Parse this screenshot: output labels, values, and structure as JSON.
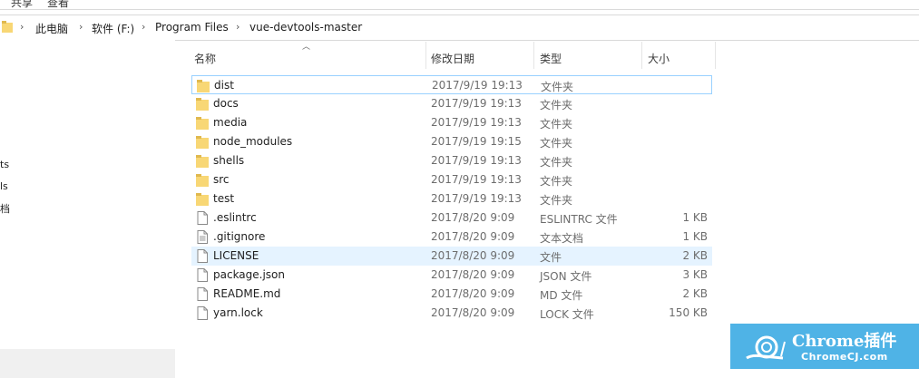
{
  "menu": {
    "items": [
      "共享",
      "查看"
    ]
  },
  "address_bar": {
    "crumbs": [
      "此电脑",
      "软件 (F:)",
      "Program Files",
      "vue-devtools-master"
    ]
  },
  "nav_pane": {
    "fragments": [
      "ts",
      "ls",
      "档"
    ]
  },
  "columns": {
    "name": "名称",
    "date": "修改日期",
    "type": "类型",
    "size": "大小"
  },
  "files": [
    {
      "name": "dist",
      "date": "2017/9/19 19:13",
      "type": "文件夹",
      "size": "",
      "icon": "folder-icon"
    },
    {
      "name": "docs",
      "date": "2017/9/19 19:13",
      "type": "文件夹",
      "size": "",
      "icon": "folder-icon"
    },
    {
      "name": "media",
      "date": "2017/9/19 19:13",
      "type": "文件夹",
      "size": "",
      "icon": "folder-icon"
    },
    {
      "name": "node_modules",
      "date": "2017/9/19 19:15",
      "type": "文件夹",
      "size": "",
      "icon": "folder-icon"
    },
    {
      "name": "shells",
      "date": "2017/9/19 19:13",
      "type": "文件夹",
      "size": "",
      "icon": "folder-icon"
    },
    {
      "name": "src",
      "date": "2017/9/19 19:13",
      "type": "文件夹",
      "size": "",
      "icon": "folder-icon"
    },
    {
      "name": "test",
      "date": "2017/9/19 19:13",
      "type": "文件夹",
      "size": "",
      "icon": "folder-icon"
    },
    {
      "name": ".eslintrc",
      "date": "2017/8/20 9:09",
      "type": "ESLINTRC 文件",
      "size": "1 KB",
      "icon": "file-icon"
    },
    {
      "name": ".gitignore",
      "date": "2017/8/20 9:09",
      "type": "文本文档",
      "size": "1 KB",
      "icon": "text-file-icon"
    },
    {
      "name": "LICENSE",
      "date": "2017/8/20 9:09",
      "type": "文件",
      "size": "2 KB",
      "icon": "file-icon"
    },
    {
      "name": "package.json",
      "date": "2017/8/20 9:09",
      "type": "JSON 文件",
      "size": "3 KB",
      "icon": "file-icon"
    },
    {
      "name": "README.md",
      "date": "2017/8/20 9:09",
      "type": "MD 文件",
      "size": "2 KB",
      "icon": "file-icon"
    },
    {
      "name": "yarn.lock",
      "date": "2017/8/20 9:09",
      "type": "LOCK 文件",
      "size": "150 KB",
      "icon": "file-icon"
    }
  ],
  "watermark": {
    "title": "Chrome插件",
    "subtitle": "ChromeCJ.com"
  },
  "colors": {
    "folder": "#f8d775",
    "selection_border": "#99d1ff",
    "hover": "#e5f3ff",
    "watermark": "#4fb3e6"
  }
}
